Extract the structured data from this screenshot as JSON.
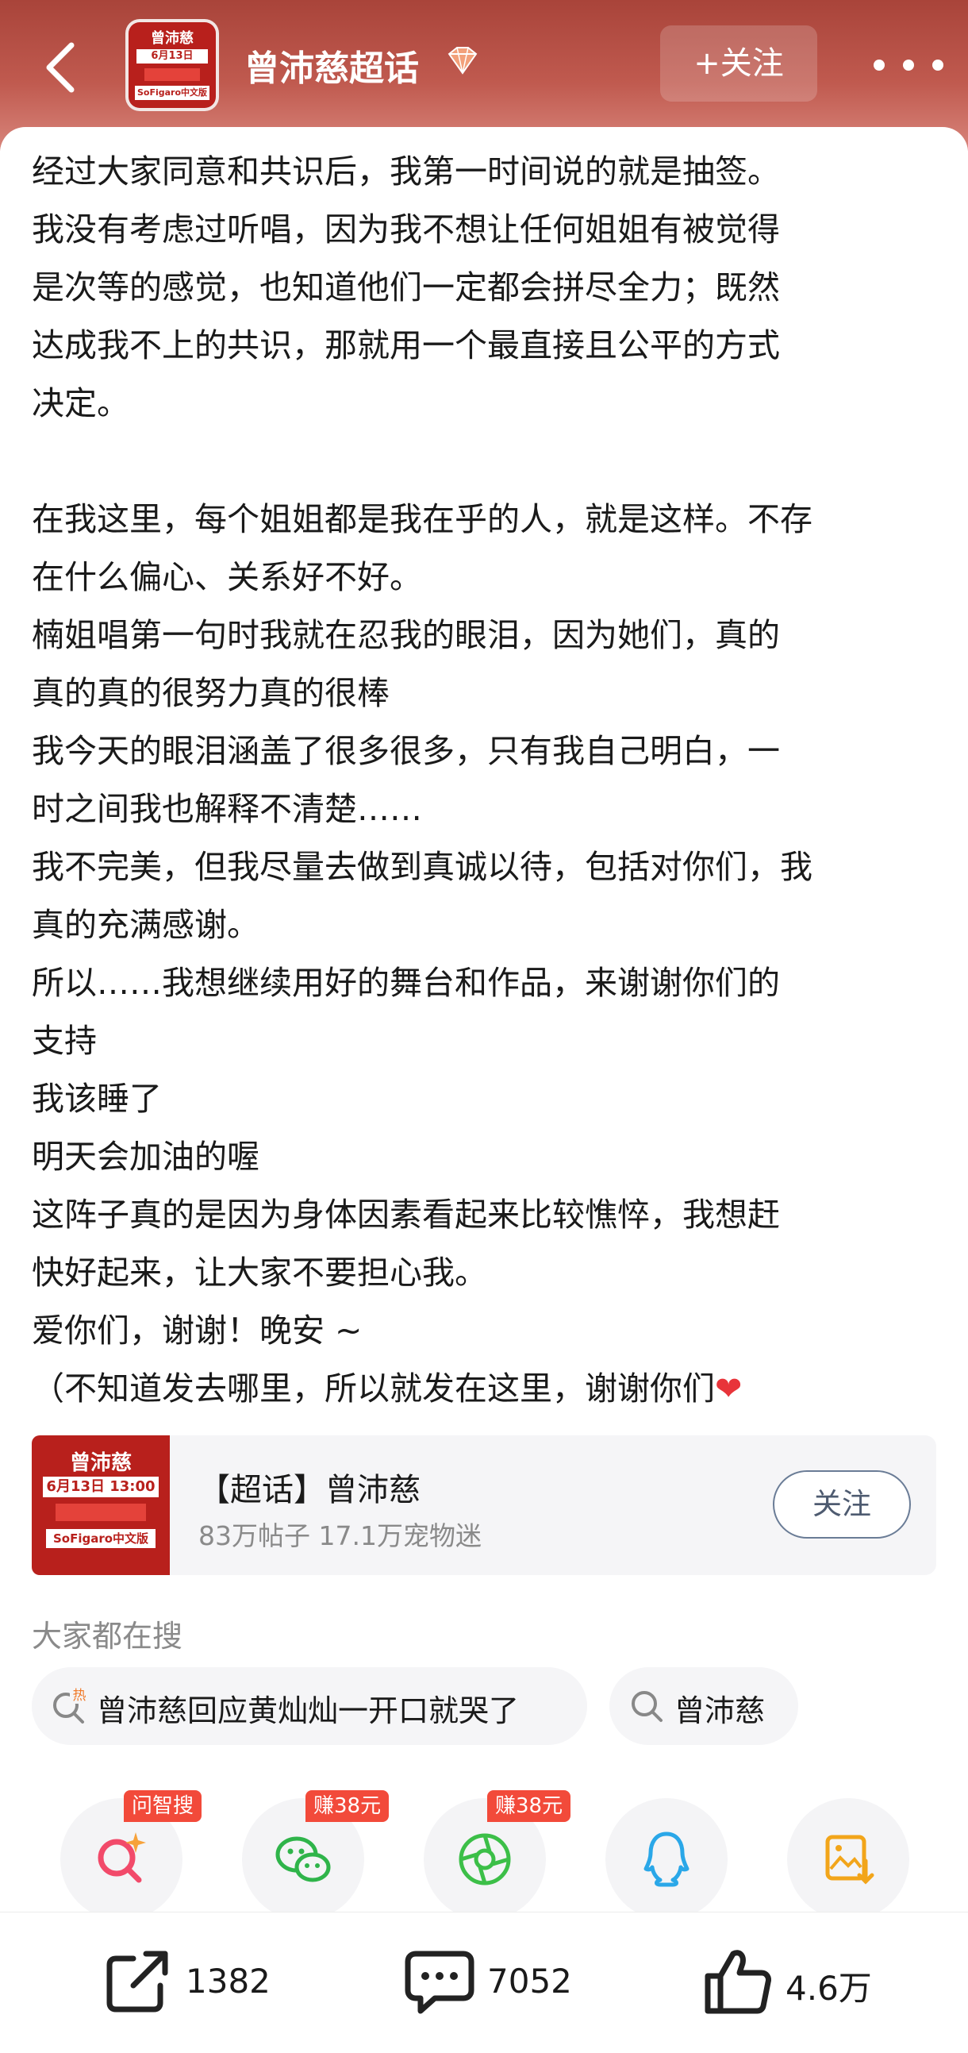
{
  "header": {
    "topic_title": "曾沛慈超话",
    "follow_label": "+关注",
    "avatar_lines": [
      "曾沛慈",
      "6月13日 13:00",
      "SoFigaro中文版"
    ]
  },
  "post": {
    "lines": [
      "经过大家同意和共识后，我第一时间说的就是抽签。",
      "我没有考虑过听唱，因为我不想让任何姐姐有被觉得",
      "是次等的感觉，也知道他们一定都会拼尽全力；既然",
      "达成我不上的共识，那就用一个最直接且公平的方式",
      "决定。",
      "",
      "在我这里，每个姐姐都是我在乎的人，就是这样。不存",
      "在什么偏心、关系好不好。",
      "楠姐唱第一句时我就在忍我的眼泪，因为她们，真的",
      "真的真的很努力真的很棒",
      "我今天的眼泪涵盖了很多很多，只有我自己明白，一",
      "时之间我也解释不清楚……",
      "我不完美，但我尽量去做到真诚以待，包括对你们，我",
      "真的充满感谢。",
      "所以……我想继续用好的舞台和作品，来谢谢你们的",
      "支持",
      "我该睡了",
      "明天会加油的喔",
      "这阵子真的是因为身体因素看起来比较憔悴，我想赶",
      "快好起来，让大家不要担心我。",
      "爱你们，谢谢！晚安 ~",
      "（不知道发去哪里，所以就发在这里，谢谢你们"
    ]
  },
  "topic_card": {
    "name": "【超话】曾沛慈",
    "stats": "83万帖子 17.1万宠物迷",
    "follow_label": "关注",
    "avatar_lines": [
      "曾沛慈",
      "6月13日 13:00",
      "SoFigaro中文版"
    ]
  },
  "search": {
    "heading": "大家都在搜",
    "hot_badge": "热",
    "items": [
      "曾沛慈回应黄灿灿一开口就哭了",
      "曾沛慈"
    ]
  },
  "share_targets": [
    {
      "icon": "ai-search-icon",
      "tag": "问智搜"
    },
    {
      "icon": "wechat-icon",
      "tag": "赚38元"
    },
    {
      "icon": "moments-icon",
      "tag": "赚38元"
    },
    {
      "icon": "qq-icon",
      "tag": ""
    },
    {
      "icon": "save-image-icon",
      "tag": ""
    }
  ],
  "actions": {
    "share_count": "1382",
    "comment_count": "7052",
    "like_count": "4.6万"
  },
  "colors": {
    "header_top": "#a9443a",
    "header_bottom": "#d8857b",
    "tag_red": "#f24a3a",
    "heart": "#e8343a",
    "follow_outline": "#6a7c96"
  }
}
